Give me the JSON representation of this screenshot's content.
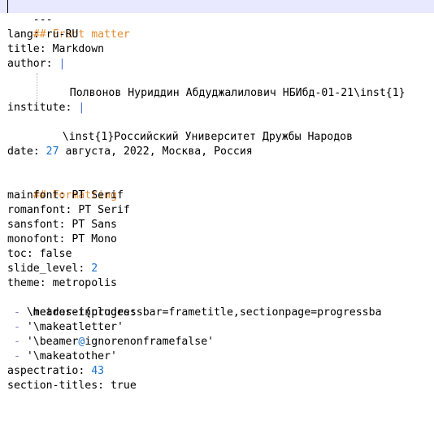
{
  "lines": {
    "l1": "---",
    "l2": "## Front matter",
    "l3_key": "lang:",
    "l3_val": " ru-RU",
    "l4_key": "title:",
    "l4_val": " Markdown",
    "l5_key": "author:",
    "l5_pipe": "|",
    "l6": "Полвонов Нуриддин Абдуджалилович НБИбд-01-21\\inst{1}",
    "l8_key": "institute:",
    "l8_pipe": "|",
    "l9": "\\inst{1}Российский Университет Дружбы Народов",
    "l11_key": "date:",
    "l11_num": "27",
    "l11_rest": " августа, 2022, Москва, Россия",
    "l13": "## Formatting",
    "l14_key": "mainfont:",
    "l14_val": " PT Serif",
    "l15_key": "romanfont:",
    "l15_val": " PT Serif",
    "l16_key": "sansfont:",
    "l16_val": " PT Sans",
    "l17_key": "monofont:",
    "l17_val": " PT Mono",
    "l18_key": "toc:",
    "l18_val": " false",
    "l19_key": "slide_level:",
    "l19_num": "2",
    "l20_key": "theme:",
    "l20_val": " metropolis",
    "l21_key": "header-includes:",
    "l22_dash": " - ",
    "l22_text": "\\metroset{progressbar=frametitle,sectionpage=progressba",
    "l23_dash": " - ",
    "l23_text": "'\\makeatletter'",
    "l24_dash": " - ",
    "l24_text_a": "'\\beamer",
    "l24_at": "@",
    "l24_text_b": "ignorenonframefalse'",
    "l25_dash": " - ",
    "l25_text": "'\\makeatother'",
    "l26_key": "aspectratio:",
    "l26_num": "43",
    "l27_key": "section-titles:",
    "l27_val": " true",
    "l29": "---"
  },
  "colors": {
    "comment": "#e68a2e",
    "number": "#1a73c9",
    "current_line": "#e8e8ff"
  }
}
